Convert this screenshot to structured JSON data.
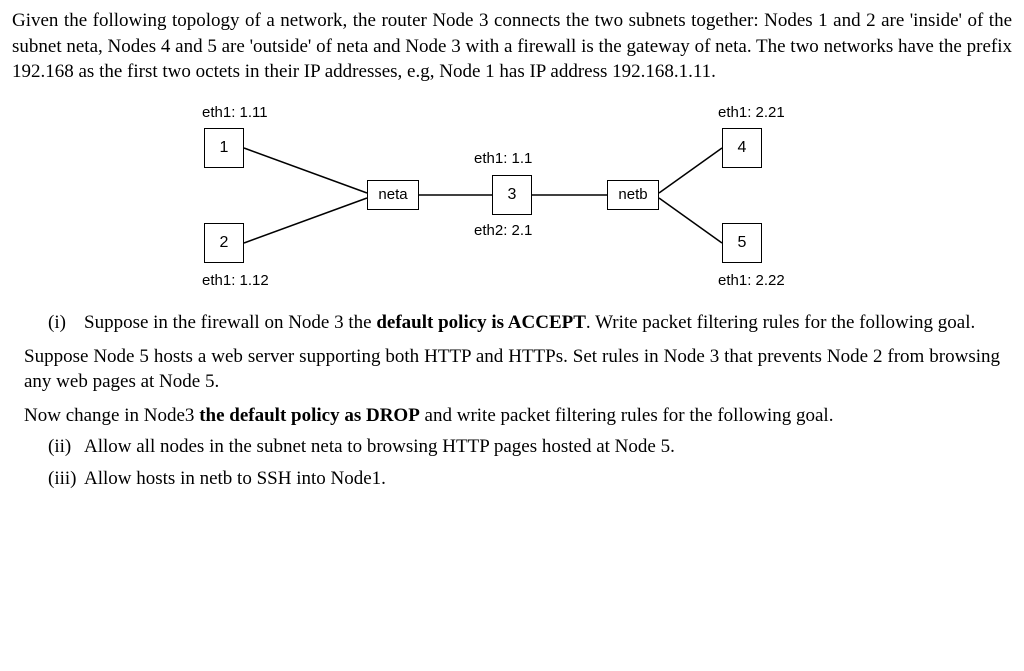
{
  "intro": "Given the following topology of a network, the router Node 3 connects the two subnets together: Nodes 1 and 2 are 'inside' of the subnet neta, Nodes 4 and 5 are 'outside' of neta and Node 3 with a firewall is the gateway of neta. The two networks have the prefix 192.168 as the first two octets in their IP addresses, e.g, Node 1 has IP address 192.168.1.11.",
  "diagram": {
    "nodes": {
      "n1": {
        "label": "1",
        "iface": "eth1: 1.11"
      },
      "n2": {
        "label": "2",
        "iface": "eth1: 1.12"
      },
      "n3": {
        "label": "3",
        "iface_top": "eth1: 1.1",
        "iface_bottom": "eth2: 2.1"
      },
      "n4": {
        "label": "4",
        "iface": "eth1: 2.21"
      },
      "n5": {
        "label": "5",
        "iface": "eth1: 2.22"
      }
    },
    "nets": {
      "neta": "neta",
      "netb": "netb"
    }
  },
  "q_i_num": "(i)",
  "q_i_text_a": "Suppose in the firewall on Node 3 the ",
  "q_i_bold1": "default policy is ACCEPT",
  "q_i_text_b": ". Write packet filtering rules for the following goal.",
  "goal_i": "Suppose Node 5 hosts a web server supporting both HTTP and HTTPs. Set rules in Node 3 that prevents Node 2 from browsing any web pages at Node 5.",
  "change_a": "Now change in Node3 ",
  "change_bold": "the default policy as DROP",
  "change_b": " and write packet filtering rules for the following goal.",
  "q_ii_num": "(ii)",
  "q_ii_text": "Allow all nodes in the subnet neta to browsing HTTP pages hosted at Node 5.",
  "q_iii_num": "(iii)",
  "q_iii_text": "Allow hosts in netb to SSH into Node1."
}
